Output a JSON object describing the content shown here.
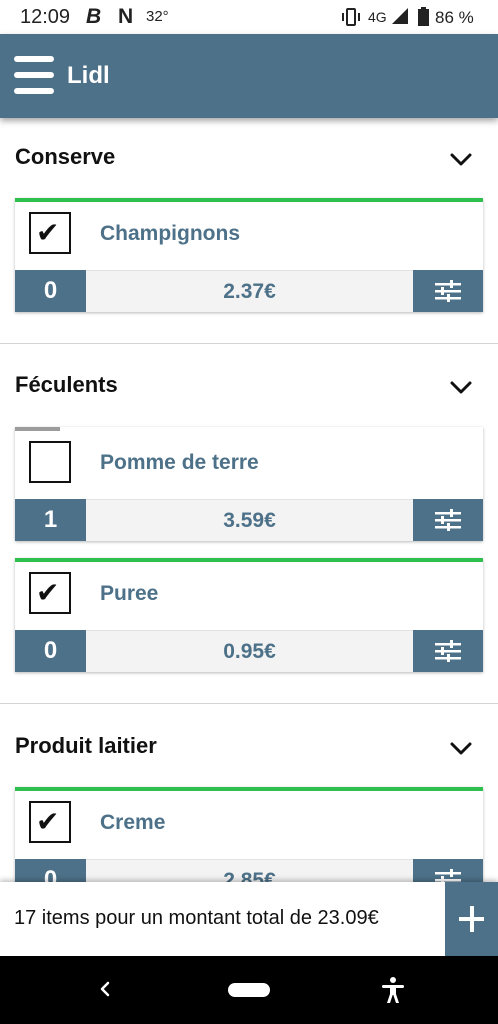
{
  "status_bar": {
    "time": "12:09",
    "app_b": "B",
    "app_n": "N",
    "temperature": "32°",
    "network": "4G",
    "battery_percent": "86 %",
    "icons": [
      "vibrate-icon",
      "signal-icon",
      "battery-icon"
    ]
  },
  "app_bar": {
    "title": "Lidl",
    "menu_icon": "hamburger-menu-icon"
  },
  "sections": [
    {
      "title": "Conserve",
      "items": [
        {
          "name": "Champignons",
          "checked": true,
          "quantity": "0",
          "price": "2.37€",
          "status": "complete"
        }
      ]
    },
    {
      "title": "Féculents",
      "items": [
        {
          "name": "Pomme de terre",
          "checked": false,
          "quantity": "1",
          "price": "3.59€",
          "status": "partial"
        },
        {
          "name": "Puree",
          "checked": true,
          "quantity": "0",
          "price": "0.95€",
          "status": "complete"
        }
      ]
    },
    {
      "title": "Produit laitier",
      "items": [
        {
          "name": "Creme",
          "checked": true,
          "quantity": "0",
          "price": "2.85€",
          "status": "complete"
        }
      ]
    }
  ],
  "tick_glyph": "✔",
  "footer": {
    "total_text": "17 items pour un montant total de 23.09€",
    "add_icon": "plus-icon"
  },
  "colors": {
    "primary": "#4d7188",
    "complete": "#2fbf4e",
    "partial": "#9c9c9c"
  }
}
